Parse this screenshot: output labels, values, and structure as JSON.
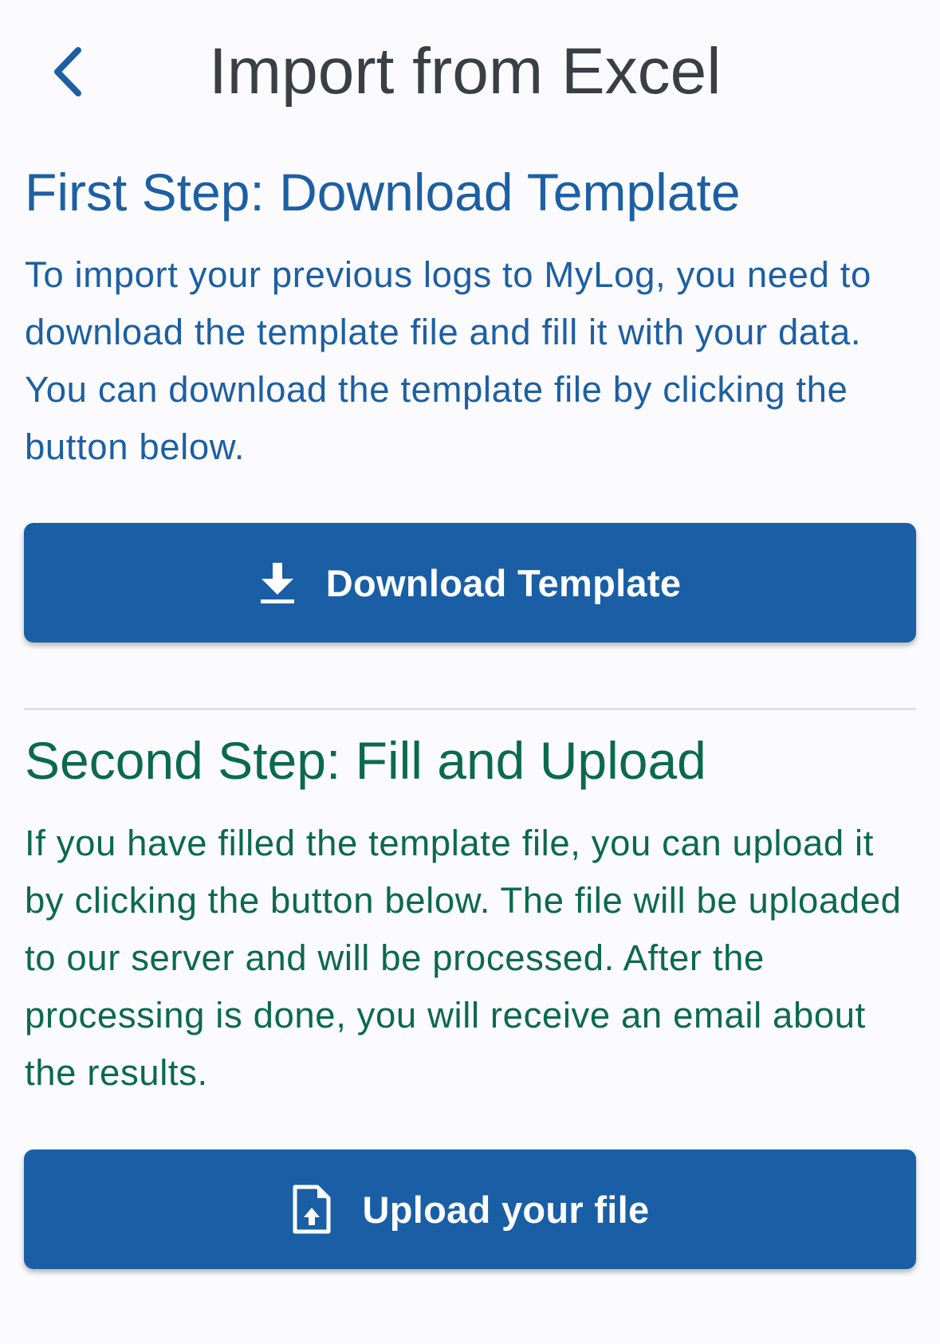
{
  "header": {
    "title": "Import from Excel",
    "back_icon": "chevron-left-icon"
  },
  "step1": {
    "heading": "First Step: Download Template",
    "body": "To import your previous logs to MyLog, you need to download the template file and fill it with your data. You can download the template file by clicking the button below.",
    "button_label": "Download Template",
    "button_icon": "download-icon"
  },
  "step2": {
    "heading": "Second Step: Fill and Upload",
    "body": "If you have filled the template file, you can upload it by clicking the button below. The file will be uploaded to our server and will be processed. After the processing is done, you will receive an email about the results.",
    "button_label": "Upload your file",
    "button_icon": "file-upload-icon"
  },
  "colors": {
    "background": "#fbfbfe",
    "title_text": "#3a3f45",
    "step1_accent": "#1d5fa3",
    "step2_accent": "#0c6a4c",
    "button_bg": "#1a5fa5",
    "button_text": "#ffffff",
    "divider": "#e1e2e6"
  }
}
